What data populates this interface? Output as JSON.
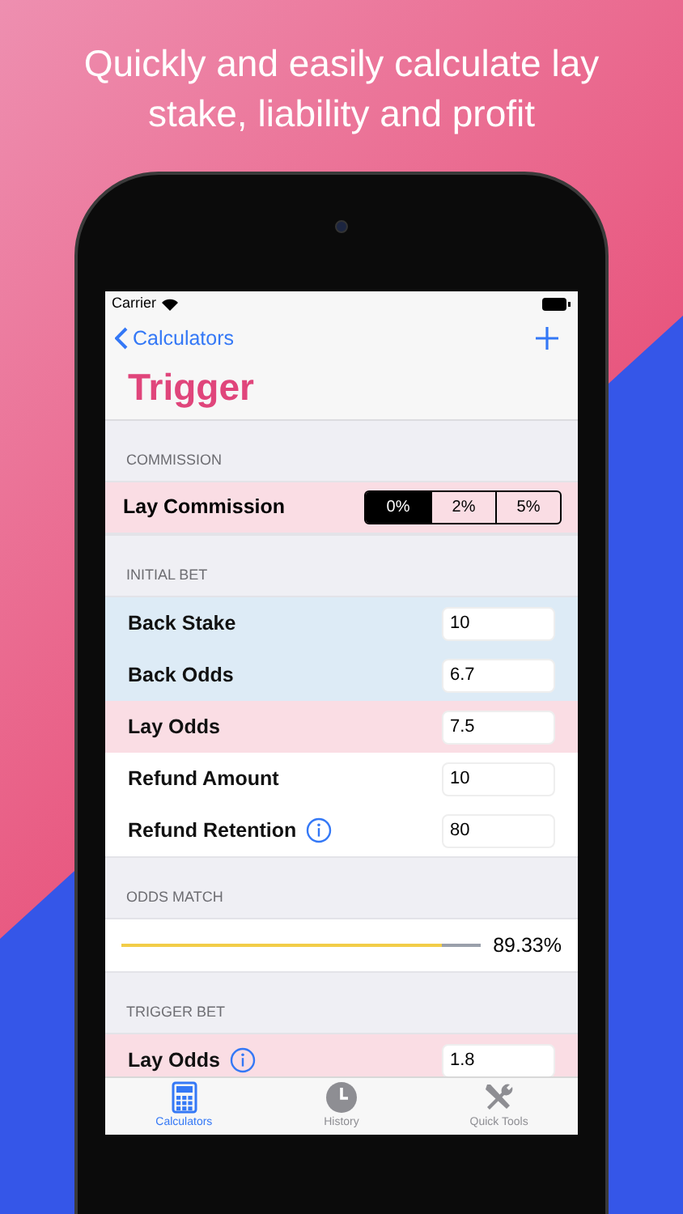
{
  "headline": "Quickly and easily calculate lay stake, liability and profit",
  "status_bar": {
    "carrier": "Carrier"
  },
  "nav": {
    "back": "Calculators",
    "title": "Trigger"
  },
  "sections": [
    {
      "header": "COMMISSION",
      "rows": [
        {
          "kind": "segmented",
          "label": "Lay Commission",
          "color": "#fadde4",
          "options": [
            {
              "label": "0%",
              "selected": true
            },
            {
              "label": "2%",
              "selected": false
            },
            {
              "label": "5%",
              "selected": false
            }
          ]
        }
      ]
    },
    {
      "header": "INITIAL BET",
      "rows": [
        {
          "kind": "input",
          "label": "Back Stake",
          "color": "#ddebf6",
          "info": false,
          "value": "10"
        },
        {
          "kind": "input",
          "label": "Back Odds",
          "color": "#ddebf6",
          "info": false,
          "value": "6.7"
        },
        {
          "kind": "input",
          "label": "Lay Odds",
          "color": "#fadde4",
          "info": false,
          "value": "7.5"
        },
        {
          "kind": "input",
          "label": "Refund Amount",
          "color": "#ffffff",
          "info": false,
          "value": "10"
        },
        {
          "kind": "input",
          "label": "Refund Retention",
          "color": "#ffffff",
          "info": true,
          "value": "80"
        }
      ]
    },
    {
      "header": "ODDS MATCH",
      "rows": [
        {
          "kind": "meter",
          "level": 0.893,
          "reading": "89.33%",
          "color": "#ffffff"
        }
      ]
    },
    {
      "header": "TRIGGER BET",
      "rows": [
        {
          "kind": "input",
          "label": "Lay Odds",
          "color": "#fadde4",
          "info": true,
          "value": "1.8"
        }
      ]
    }
  ],
  "tab_bar": [
    {
      "label": "Calculators",
      "selected": true,
      "kind": "calculator"
    },
    {
      "label": "History",
      "selected": false,
      "kind": "clock"
    },
    {
      "label": "Quick Tools",
      "selected": false,
      "kind": "tools"
    }
  ]
}
